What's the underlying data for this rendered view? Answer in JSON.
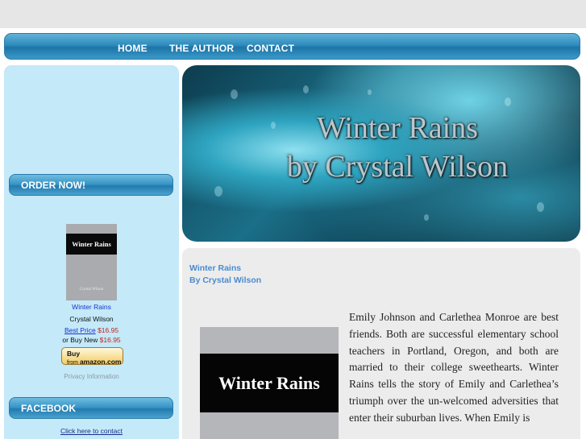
{
  "nav": {
    "items": [
      "HOME",
      "THE AUTHOR",
      "CONTACT"
    ]
  },
  "sidebar": {
    "order_header": "ORDER NOW!",
    "book_cover": {
      "title": "Winter Rains",
      "author": "Crystal Wilson"
    },
    "product_title": "Winter Rains",
    "product_author": "Crystal Wilson",
    "best_price_label": "Best Price",
    "best_price": "$16.95",
    "buy_new_label": "or Buy New",
    "buy_new_price": "$16.95",
    "amazon_button": {
      "line1": "Buy",
      "line2": "from",
      "brand": "amazon.com"
    },
    "privacy": "Privacy Information",
    "facebook_header": "FACEBOOK",
    "contact_link": "Click here to contact"
  },
  "banner": {
    "line1": "Winter Rains",
    "line2": "by Crystal Wilson"
  },
  "main": {
    "heading1": "Winter Rains",
    "heading2": "By Crystal Wilson",
    "book_cover_title": "Winter Rains",
    "paragraph": "Emily Johnson and Carlethea Monroe are best friends. Both are successful elementary school teachers in Portland, Oregon, and both are married to their college sweethearts. Winter Rains tells the story of Emily and Carlethea’s triumph over the un-welcomed adversities that enter their suburban lives. When Emily is"
  },
  "colors": {
    "nav_blue": "#2f8bbd",
    "sidebar_bg": "#c4e9f8",
    "heading_blue": "#4a8bd0",
    "price_red": "#c0271b",
    "link_blue": "#1a33c9"
  }
}
